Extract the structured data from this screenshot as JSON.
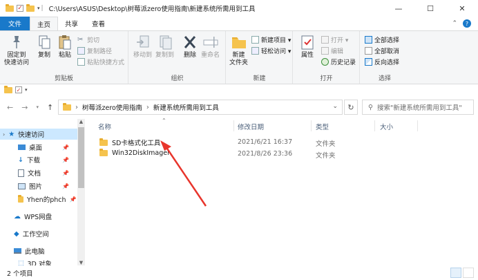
{
  "window": {
    "title": "C:\\Users\\ASUS\\Desktop\\树莓派zero使用指南\\新建系统所需用到工具",
    "min_glyph": "—",
    "max_glyph": "☐",
    "close_glyph": "✕"
  },
  "ribbon_tabs": [
    "文件",
    "主页",
    "共享",
    "查看"
  ],
  "ribbon": {
    "clipboard": {
      "pin_label_1": "固定到",
      "pin_label_2": "快速访问",
      "copy_label": "复制",
      "paste_label": "粘贴",
      "cut_label": "剪切",
      "copy_path_label": "复制路径",
      "paste_shortcut_label": "粘贴快捷方式",
      "group_label": "剪贴板"
    },
    "organize": {
      "move_to_label": "移动到",
      "copy_to_label": "复制到",
      "delete_label": "删除",
      "rename_label": "重命名",
      "group_label": "组织"
    },
    "new": {
      "new_folder_label_1": "新建",
      "new_folder_label_2": "文件夹",
      "new_item_label": "新建项目 ▾",
      "easy_access_label": "轻松访问 ▾",
      "group_label": "新建"
    },
    "open": {
      "properties_label": "属性",
      "open_label": "打开 ▾",
      "edit_label": "编辑",
      "history_label": "历史记录",
      "group_label": "打开"
    },
    "select": {
      "select_all_label": "全部选择",
      "select_none_label": "全部取消",
      "invert_label": "反向选择",
      "group_label": "选择"
    }
  },
  "address": {
    "crumbs": [
      "树莓派zero使用指南",
      "新建系统所需用到工具"
    ],
    "search_placeholder": "搜索\"新建系统所需用到工具\""
  },
  "nav_pane": {
    "items": [
      {
        "label": "快速访问",
        "icon": "star-icon"
      },
      {
        "label": "桌面",
        "icon": "desktop-icon"
      },
      {
        "label": "下载",
        "icon": "download-icon"
      },
      {
        "label": "文档",
        "icon": "document-icon"
      },
      {
        "label": "图片",
        "icon": "picture-icon"
      },
      {
        "label": "Yhen的phch",
        "icon": "folder-icon"
      },
      {
        "label": "WPS网盘",
        "icon": "cloud-icon"
      },
      {
        "label": "工作空间",
        "icon": "workspace-icon"
      },
      {
        "label": "此电脑",
        "icon": "computer-icon"
      },
      {
        "label": "3D 对象",
        "icon": "3d-objects-icon"
      }
    ]
  },
  "file_list": {
    "columns": [
      "名称",
      "修改日期",
      "类型",
      "大小"
    ],
    "rows": [
      {
        "name": "SD卡格式化工具",
        "date": "2021/6/21 16:37",
        "type": "文件夹"
      },
      {
        "name": "Win32DiskImager",
        "date": "2021/8/26 23:36",
        "type": "文件夹"
      }
    ]
  },
  "status": {
    "count_text": "2 个项目"
  },
  "colors": {
    "accent": "#1979ca",
    "folder": "#f5c34e",
    "annotation_arrow": "#e8352c"
  }
}
